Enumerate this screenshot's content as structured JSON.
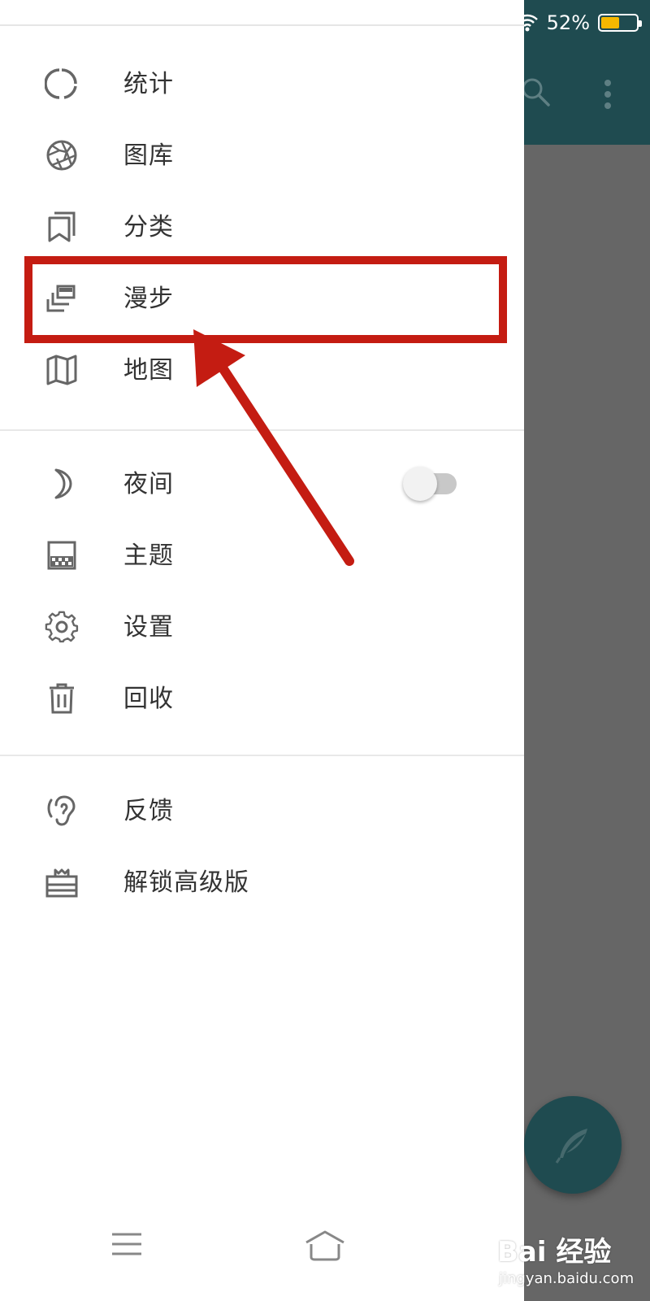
{
  "status_bar": {
    "battery_percent_text": "52%",
    "battery_level": 0.52
  },
  "drawer": {
    "groups": [
      [
        {
          "label": "统计",
          "icon": "circle-stats-icon"
        },
        {
          "label": "图库",
          "icon": "aperture-icon"
        },
        {
          "label": "分类",
          "icon": "bookmark-icon"
        },
        {
          "label": "漫步",
          "icon": "stack-cards-icon"
        },
        {
          "label": "地图",
          "icon": "map-icon"
        }
      ],
      [
        {
          "label": "夜间",
          "icon": "moon-icon"
        },
        {
          "label": "主题",
          "icon": "theme-icon"
        },
        {
          "label": "设置",
          "icon": "gear-icon"
        },
        {
          "label": "回收",
          "icon": "trash-icon"
        }
      ],
      [
        {
          "label": "反馈",
          "icon": "ear-icon"
        },
        {
          "label": "解锁高级版",
          "icon": "gift-icon"
        }
      ]
    ],
    "night_mode_enabled": false
  },
  "background_app": {
    "toolbar_color": "#1f4b50",
    "overlay_color": "#666666"
  },
  "colors": {
    "annotation": "#c41c12",
    "icon": "#666666",
    "text": "#333333"
  },
  "watermark": {
    "logo_text": "Bai 经验",
    "url_text": "jingyan.baidu.com"
  }
}
